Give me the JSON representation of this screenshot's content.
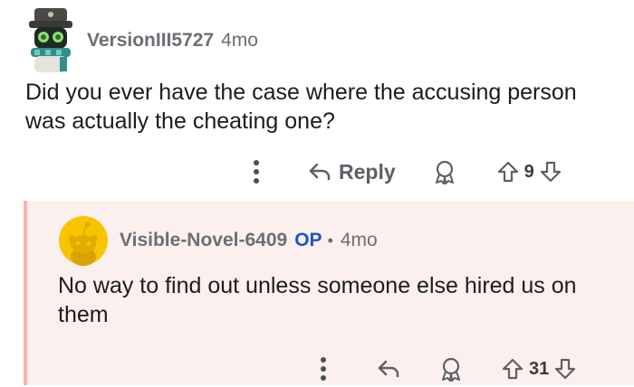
{
  "comment": {
    "username": "VersionIII5727",
    "time": "4mo",
    "body": "Did you ever have the case where the accusing person was actually the cheating one?",
    "actions": {
      "reply_label": "Reply",
      "vote_count": "9"
    }
  },
  "reply": {
    "username": "Visible-Novel-6409",
    "op_badge": "OP",
    "separator": "•",
    "time": "4mo",
    "body": "No way to find out unless someone else hired us on them",
    "actions": {
      "vote_count": "31"
    }
  }
}
